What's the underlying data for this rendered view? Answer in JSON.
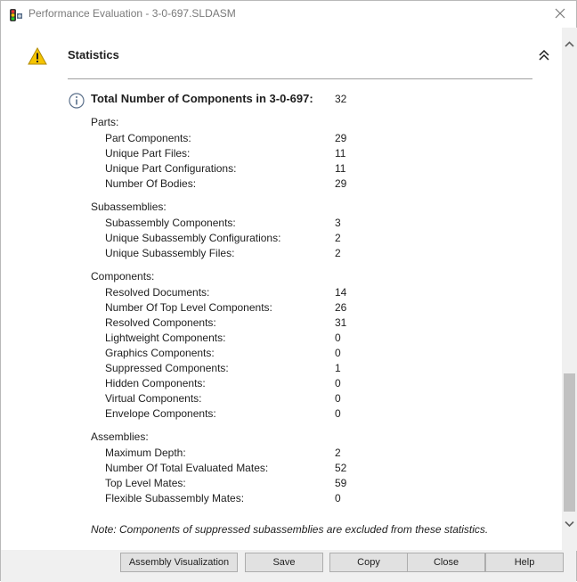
{
  "window": {
    "title": "Performance Evaluation - 3-0-697.SLDASM"
  },
  "statistics": {
    "title": "Statistics",
    "total_label": "Total Number of Components in 3-0-697:",
    "total_value": "32",
    "groups": [
      {
        "heading": "Parts:",
        "rows": [
          {
            "label": "Part Components:",
            "value": "29"
          },
          {
            "label": "Unique Part Files:",
            "value": "11"
          },
          {
            "label": "Unique Part Configurations:",
            "value": "11"
          },
          {
            "label": "Number Of Bodies:",
            "value": "29"
          }
        ]
      },
      {
        "heading": "Subassemblies:",
        "rows": [
          {
            "label": "Subassembly Components:",
            "value": "3"
          },
          {
            "label": "Unique Subassembly Configurations:",
            "value": "2"
          },
          {
            "label": "Unique Subassembly Files:",
            "value": "2"
          }
        ]
      },
      {
        "heading": "Components:",
        "rows": [
          {
            "label": "Resolved Documents:",
            "value": "14"
          },
          {
            "label": "Number Of Top Level Components:",
            "value": "26"
          },
          {
            "label": "Resolved Components:",
            "value": "31"
          },
          {
            "label": "Lightweight Components:",
            "value": "0"
          },
          {
            "label": "Graphics Components:",
            "value": "0"
          },
          {
            "label": "Suppressed Components:",
            "value": "1"
          },
          {
            "label": "Hidden Components:",
            "value": "0"
          },
          {
            "label": "Virtual Components:",
            "value": "0"
          },
          {
            "label": "Envelope Components:",
            "value": "0"
          }
        ]
      },
      {
        "heading": "Assemblies:",
        "rows": [
          {
            "label": "Maximum Depth:",
            "value": "2"
          },
          {
            "label": "Number Of Total Evaluated Mates:",
            "value": "52"
          },
          {
            "label": "Top Level Mates:",
            "value": "59"
          },
          {
            "label": "Flexible Subassembly Mates:",
            "value": "0"
          }
        ]
      }
    ],
    "note": "Note: Components of suppressed subassemblies are excluded from these statistics."
  },
  "buttons": {
    "assembly_visualization": "Assembly Visualization",
    "save": "Save",
    "copy": "Copy",
    "close": "Close",
    "help": "Help"
  },
  "icons": {
    "app": "solidworks-traffic-light-icon",
    "warning": "warning-icon",
    "info": "info-icon",
    "collapse": "double-chevron-up-icon",
    "close": "close-icon"
  },
  "colors": {
    "warning_fill": "#f5c400",
    "divider": "#a0a0a0"
  }
}
